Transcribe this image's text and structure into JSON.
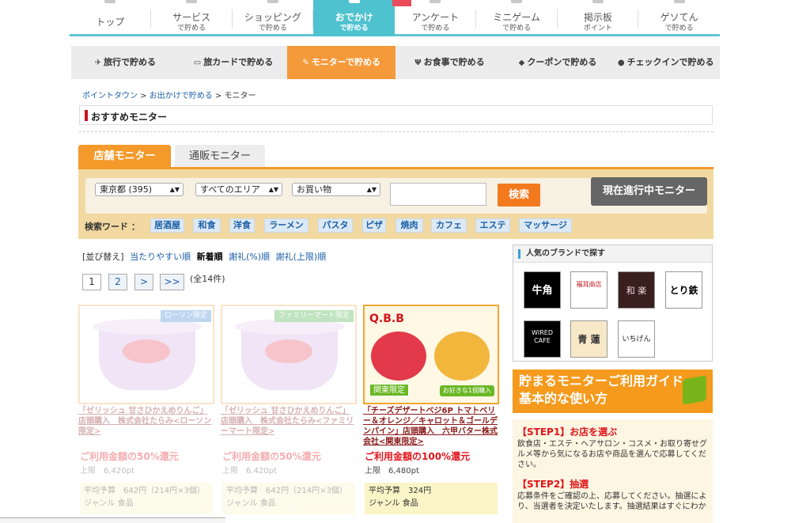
{
  "top_nav": [
    {
      "l1": "トップ",
      "l2": ""
    },
    {
      "l1": "サービス",
      "l2": "で貯める"
    },
    {
      "l1": "ショッピング",
      "l2": "で貯める"
    },
    {
      "l1": "おでかけ",
      "l2": "で貯める"
    },
    {
      "l1": "アンケート",
      "l2": "で貯める"
    },
    {
      "l1": "ミニゲーム",
      "l2": "で貯める"
    },
    {
      "l1": "掲示板",
      "l2": "ポイント"
    },
    {
      "l1": "ゲソてん",
      "l2": "で貯める"
    }
  ],
  "sub_nav": [
    {
      "icon": "✈",
      "label": "旅行で貯める"
    },
    {
      "icon": "▭",
      "label": "旅カードで貯める"
    },
    {
      "icon": "✎",
      "label": "モニターで貯める"
    },
    {
      "icon": "Ψ",
      "label": "お食事で貯める"
    },
    {
      "icon": "◆",
      "label": "クーポンで貯める"
    },
    {
      "icon": "●",
      "label": "チェックインで貯める"
    }
  ],
  "breadcrumb": {
    "a": "ポイントタウン",
    "b": "お出かけで貯める",
    "c": "モニター",
    "sep": " > "
  },
  "section_title": "おすすめモニター",
  "tabs": {
    "shop": "店舗モニター",
    "mail": "通販モニター"
  },
  "filters": {
    "pref": "東京都 (395)",
    "area": "すべてのエリア",
    "category": "お買い物",
    "search": "検索",
    "live": "現在進行中モニター"
  },
  "keywords": {
    "label": "検索ワード ：",
    "items": [
      "居酒屋",
      "和食",
      "洋食",
      "ラーメン",
      "パスタ",
      "ピザ",
      "焼肉",
      "カフェ",
      "エステ",
      "マッサージ"
    ]
  },
  "sort": {
    "label": "[並び替え]",
    "opt1": "当たりやすい順",
    "opt2": "新着順",
    "opt3": "謝礼(%)順",
    "opt4": "謝礼(上限)順"
  },
  "pagination": {
    "p1": "1",
    "p2": "2",
    "next": ">",
    "last": ">>",
    "total": "(全14件)"
  },
  "cards": [
    {
      "badge": "ローソン限定",
      "title": "「ゼリッシュ 甘さひかえめりんご」店頭購入　株式会社たらみ<ローソン限定>",
      "rate": "ご利用金額の50%還元",
      "limit": "上限　6,420pt",
      "avg": "平均予算　642円（214円×3個）",
      "genre": "ジャンル 食品",
      "badge_color": "#4a8cd8"
    },
    {
      "badge": "ファミリーマート限定",
      "title": "「ゼリッシュ 甘さひかえめりんご」店頭購入　株式会社たらみ<ファミリーマート限定>",
      "rate": "ご利用金額の50%還元",
      "limit": "上限　6,420pt",
      "avg": "平均予算　642円（214円×3個）",
      "genre": "ジャンル 食品",
      "badge_color": "#4bb34b"
    },
    {
      "badge": "関東限定",
      "title": "「チーズデザートベジ6P トマトベリー＆オレンジ／キャロット＆ゴールデンパイン」店頭購入　六甲バター株式会社<関東限定>",
      "rate": "ご利用金額の100%還元",
      "limit": "上限　6,480pt",
      "avg": "平均予算　324円",
      "genre": "ジャンル 食品",
      "brand": "Q.B.B",
      "ribbon": "お好きな1個購入"
    }
  ],
  "brand_box": {
    "title": "人気のブランドで探す",
    "logos": [
      "牛角",
      "福耳商店",
      "和 楽",
      "とり鉄",
      "WIRED CAFE",
      "青 蓮",
      "いちげん"
    ]
  },
  "guide": {
    "line1": "貯まるモニターご利用ガイド",
    "line2": "基本的な使い方"
  },
  "steps": [
    {
      "title": "【STEP1】お店を選ぶ",
      "text": "飲食店・エステ・ヘアサロン・コスメ・お取り寄せグルメ等から気になるお店や商品を選んで応募してください。"
    },
    {
      "title": "【STEP2】抽選",
      "text": "応募条件をご確認の上、応募してください。抽選により、当選者を決定いたします。抽選結果はすぐにわか"
    }
  ]
}
